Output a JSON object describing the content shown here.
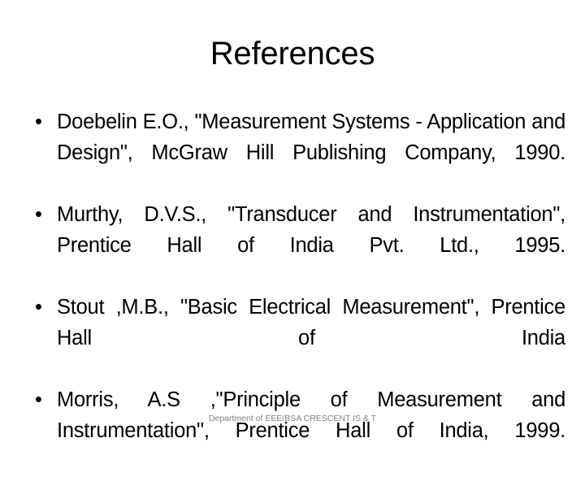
{
  "slide": {
    "title": "References",
    "background_color": "#ffffff",
    "text_color": "#000000",
    "footer_color": "#808080"
  },
  "bullets": [
    {
      "marker": "•",
      "text": "Doebelin E.O., \"Measurement Systems - Application and Design\", McGraw Hill Publishing Company, 1990."
    },
    {
      "marker": "•",
      "text": "Murthy, D.V.S., \"Transducer and Instrumentation\", Prentice Hall of India Pvt. Ltd., 1995."
    },
    {
      "marker": "•",
      "text": "Stout ,M.B., \"Basic Electrical Measurement\", Prentice Hall of India"
    },
    {
      "marker": "•",
      "text": "Morris, A.S ,\"Principle of Measurement and Instrumentation\", Prentice Hall of India, 1999."
    }
  ],
  "footer": {
    "text": "Department of EEE/BSA CRESCENT IS & T"
  }
}
